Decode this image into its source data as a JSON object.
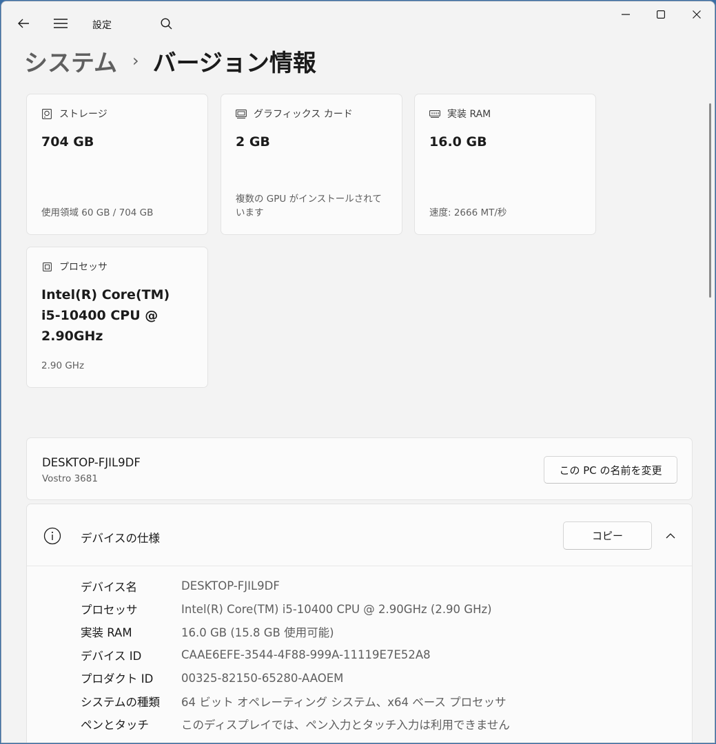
{
  "app": {
    "title": "設定"
  },
  "breadcrumb": {
    "parent": "システム",
    "separator": "›",
    "current": "バージョン情報"
  },
  "cards": [
    {
      "id": "storage",
      "icon": "hard-drive-icon",
      "label": "ストレージ",
      "value": "704 GB",
      "sub": "使用領域 60 GB / 704 GB"
    },
    {
      "id": "graphics",
      "icon": "graphics-card-icon",
      "label": "グラフィックス カード",
      "value": "2 GB",
      "sub": "複数の GPU がインストールされています"
    },
    {
      "id": "ram",
      "icon": "memory-icon",
      "label": "実装 RAM",
      "value": "16.0 GB",
      "sub": "速度: 2666 MT/秒"
    },
    {
      "id": "processor",
      "icon": "processor-icon",
      "label": "プロセッサ",
      "value": "Intel(R) Core(TM) i5-10400 CPU @ 2.90GHz",
      "sub": "2.90 GHz"
    }
  ],
  "pc": {
    "name": "DESKTOP-FJIL9DF",
    "model": "Vostro 3681",
    "rename_label": "この PC の名前を変更"
  },
  "specs": {
    "title": "デバイスの仕様",
    "copy_label": "コピー",
    "rows": [
      {
        "key": "デバイス名",
        "value": "DESKTOP-FJIL9DF"
      },
      {
        "key": "プロセッサ",
        "value": "Intel(R) Core(TM) i5-10400 CPU @ 2.90GHz (2.90 GHz)"
      },
      {
        "key": "実装 RAM",
        "value": "16.0 GB (15.8 GB 使用可能)"
      },
      {
        "key": "デバイス ID",
        "value": "CAAE6EFE-3544-4F88-999A-11119E7E52A8"
      },
      {
        "key": "プロダクト ID",
        "value": "00325-82150-65280-AAOEM"
      },
      {
        "key": "システムの種類",
        "value": "64 ビット オペレーティング システム、x64 ベース プロセッサ"
      },
      {
        "key": "ペンとタッチ",
        "value": "このディスプレイでは、ペン入力とタッチ入力は利用できません"
      }
    ]
  }
}
